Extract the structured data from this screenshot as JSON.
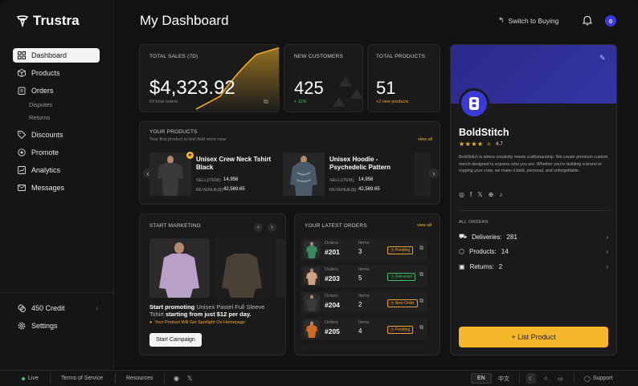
{
  "brand": {
    "name": "Trustra"
  },
  "sidebar": {
    "items": [
      {
        "label": "Dashboard"
      },
      {
        "label": "Products"
      },
      {
        "label": "Orders"
      },
      {
        "label": "Discounts"
      },
      {
        "label": "Promote"
      },
      {
        "label": "Analytics"
      },
      {
        "label": "Messages"
      }
    ],
    "order_sub": [
      "Disputes",
      "Returns"
    ],
    "credit": "450 Credit",
    "settings": "Settings"
  },
  "header": {
    "title": "My Dashboard",
    "switch_label": "Switch to Buying",
    "notif_count": "0"
  },
  "stats": {
    "sales": {
      "label": "TOTAL SALES (7D)",
      "value": "$4,323.92",
      "sub": "69 total orders"
    },
    "customers": {
      "label": "NEW CUSTOMERS",
      "value": "425",
      "sub": "+ 11%"
    },
    "products": {
      "label": "TOTAL PRODUCTS",
      "value": "51",
      "sub": "+2 new products"
    }
  },
  "your_products": {
    "title": "YOUR PRODUCTS",
    "hint": "Your first product is live! Add more now.",
    "view_all": "view all",
    "items": [
      {
        "name": "Unisex Crew Neck Tshirt Black",
        "sell_label": "SELL(ITEM):",
        "sell": "14,956",
        "rev_label": "REVENUE($):",
        "revenue": "42,569.65"
      },
      {
        "name": "Unisex Hoodie - Psychedelic Pattern",
        "sell_label": "SELL(ITEM):",
        "sell": "14,956",
        "rev_label": "REVENUE($):",
        "revenue": "42,569.65"
      }
    ]
  },
  "marketing": {
    "title": "START MARKETING",
    "text_pre": "Start promoting",
    "product": "Unisex Pastel Full Sleeve Tshirt",
    "text_post": "starting from just $12 per day.",
    "note": "Your Product Will Get Spotlight On Homepage",
    "button": "Start Campaign"
  },
  "orders": {
    "title": "YOUR LATEST ORDERS",
    "view_all": "view all",
    "orders_label": "Orders",
    "items_label": "Items",
    "rows": [
      {
        "id": "#201",
        "items": "3",
        "status": "Pending",
        "color": "#f0a030"
      },
      {
        "id": "#203",
        "items": "5",
        "status": "Delivered",
        "color": "#40c060"
      },
      {
        "id": "#204",
        "items": "2",
        "status": "New Order",
        "color": "#f0a030"
      },
      {
        "id": "#205",
        "items": "4",
        "status": "Pending",
        "color": "#f0a030"
      }
    ]
  },
  "store": {
    "name": "BoldStitch",
    "rating": "4.7",
    "desc": "BoldStitch is where creativity meets craftsmanship. We create premium custom merch designed to express who you are. Whether you're building a brand or repping your crew, we make it bold, personal, and unforgettable.",
    "all_orders": "ALL ORDERS",
    "deliveries_label": "Deliveries:",
    "deliveries": "281",
    "products_label": "Products:",
    "products": "14",
    "returns_label": "Returns:",
    "returns": "2",
    "list_button": "+ List Product",
    "accent": "#f5b82a"
  },
  "footer": {
    "live": "Live",
    "terms": "Terms of Service",
    "resources": "Resources",
    "lang_en": "EN",
    "lang_zh": "中文",
    "support": "Support"
  }
}
